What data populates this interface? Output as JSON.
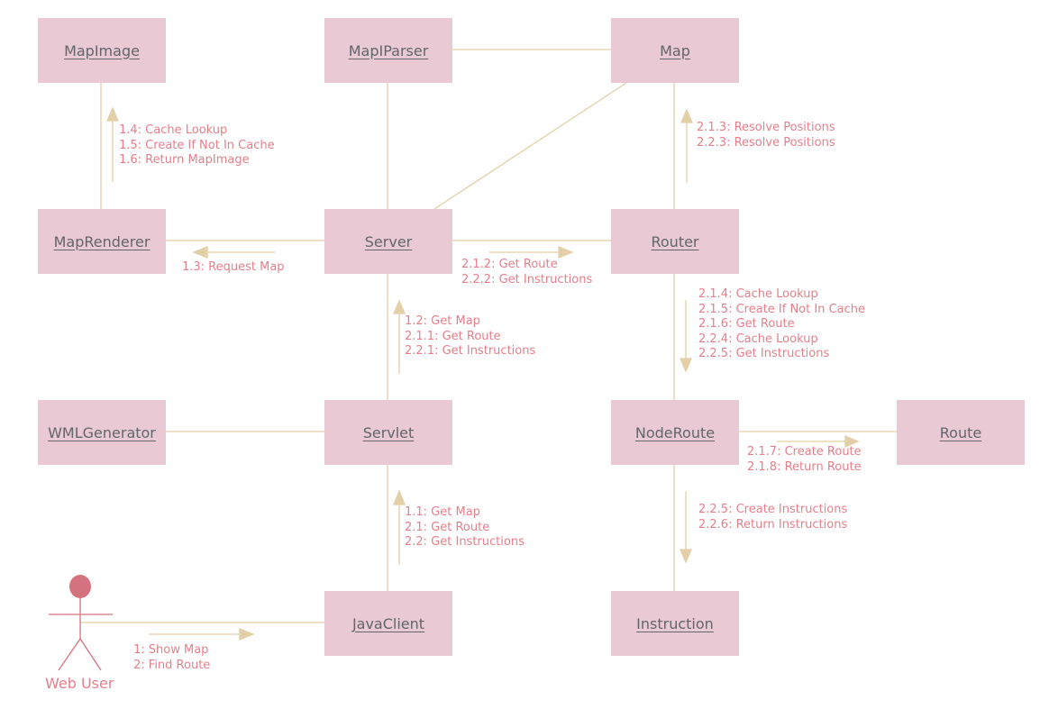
{
  "colors": {
    "box_fill": "#e9cad4",
    "box_text": "#62656a",
    "connector": "#e3cfa8",
    "message_text": "#e77f8a",
    "actor": "#d4737f"
  },
  "objects": {
    "mapimage": "MapImage",
    "mapiparser": "MapIParser",
    "map": "Map",
    "maprenderer": "MapRenderer",
    "server": "Server",
    "router": "Router",
    "wmlgenerator": "WMLGenerator",
    "servlet": "Servlet",
    "noderoute": "NodeRoute",
    "route": "Route",
    "javaclient": "JavaClient",
    "instruction": "Instruction"
  },
  "actor": {
    "name": "Web User",
    "icon": "stick-figure-icon"
  },
  "messages": {
    "user_to_javaclient": [
      "1: Show Map",
      "2: Find Route"
    ],
    "javaclient_to_servlet": [
      "1.1: Get Map",
      "2.1: Get Route",
      "2.2: Get Instructions"
    ],
    "servlet_to_server": [
      "1.2: Get Map",
      "2.1.1: Get Route",
      "2.2.1: Get Instructions"
    ],
    "server_to_maprenderer": [
      "1.3: Request Map"
    ],
    "maprenderer_to_mapimage": [
      "1.4: Cache Lookup",
      "1.5: Create If Not In Cache",
      "1.6: Return MapImage"
    ],
    "server_to_router": [
      "2.1.2: Get Route",
      "2.2.2: Get Instructions"
    ],
    "router_to_map": [
      "2.1.3: Resolve Positions",
      "2.2.3: Resolve Positions"
    ],
    "router_to_noderoute": [
      "2.1.4: Cache Lookup",
      "2.1.5: Create If Not In Cache",
      "2.1.6: Get Route",
      "2.2.4: Cache Lookup",
      "2.2.5: Get Instructions"
    ],
    "noderoute_to_route": [
      "2.1.7: Create Route",
      "2.1.8: Return Route"
    ],
    "noderoute_to_instruction": [
      "2.2.5: Create Instructions",
      "2.2.6: Return Instructions"
    ]
  }
}
